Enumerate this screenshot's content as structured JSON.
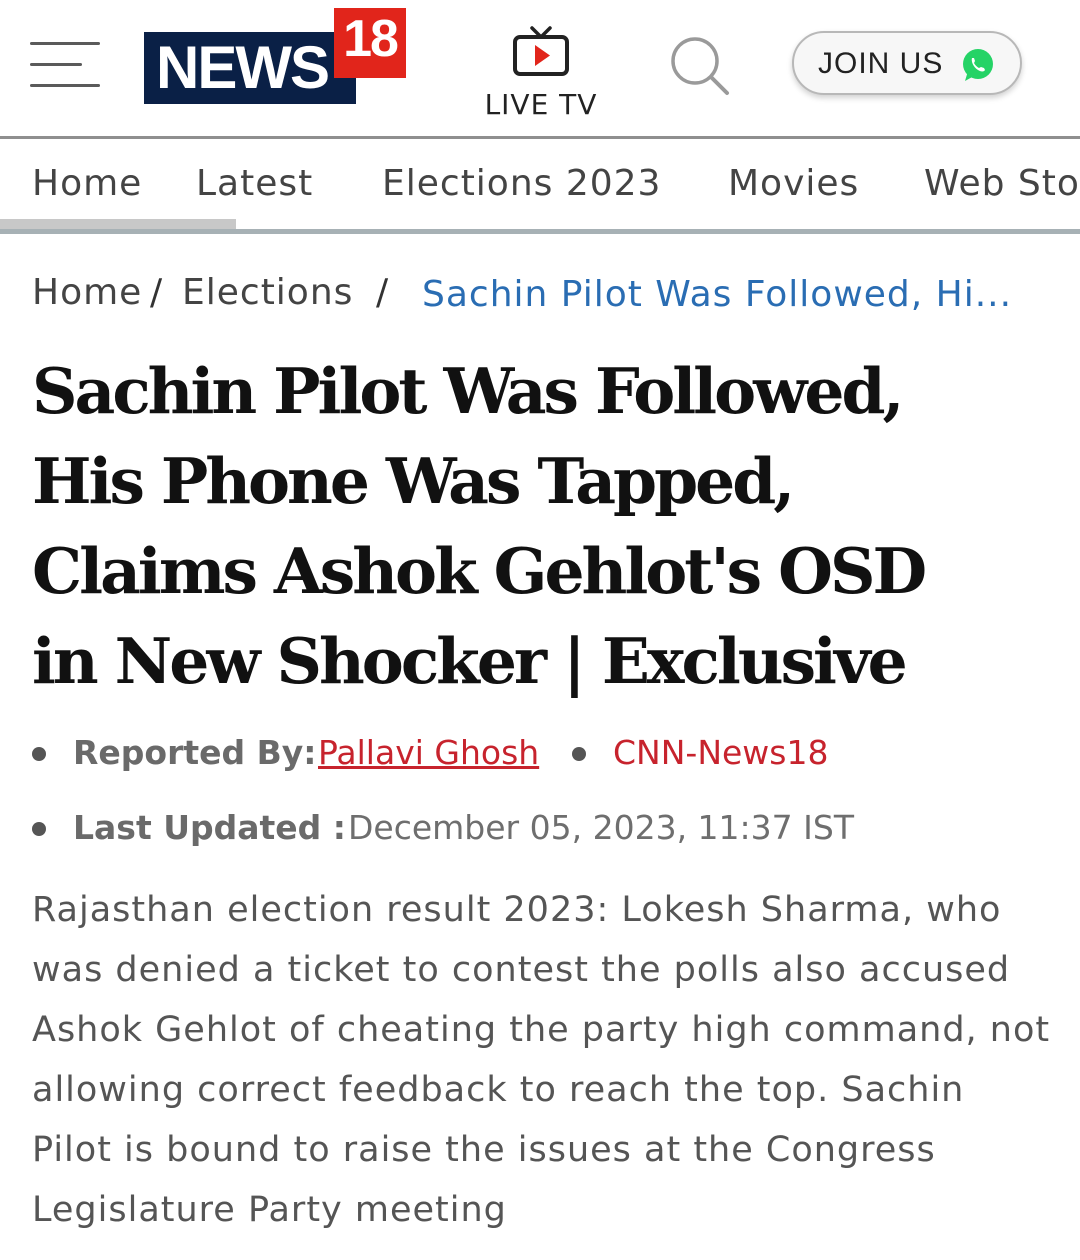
{
  "header": {
    "logo_text": "NEWS",
    "logo_number": "18",
    "live_tv_label": "LIVE TV",
    "join_label": "JOIN US",
    "icons": [
      "menu-icon",
      "live-tv-icon",
      "search-icon",
      "whatsapp-icon"
    ],
    "colors": {
      "logo_navy": "#0a2046",
      "logo_red": "#e1251b",
      "whatsapp_green": "#25d366"
    }
  },
  "nav": {
    "items": [
      {
        "label": "Home",
        "active": true
      },
      {
        "label": "Latest"
      },
      {
        "label": "Elections 2023"
      },
      {
        "label": "Movies"
      },
      {
        "label": "Web Sto"
      }
    ]
  },
  "breadcrumb": {
    "home": "Home",
    "section": "Elections",
    "separator": "/",
    "current": "Sachin Pilot Was Followed, Hi..."
  },
  "article": {
    "headline_lines": [
      "Sachin Pilot Was Followed,",
      "His Phone Was Tapped,",
      "Claims Ashok Gehlot's OSD",
      "in New Shocker | Exclusive"
    ],
    "reported_by_label": "Reported By:",
    "author": "Pallavi Ghosh",
    "source": "CNN-News18",
    "last_updated_label": "Last Updated :",
    "last_updated": "December 05, 2023, 11:37 IST",
    "summary": "Rajasthan election result 2023: Lokesh Sharma, who was denied a ticket to contest the polls also accused Ashok Gehlot of cheating the party high command, not allowing correct feedback to reach the top. Sachin Pilot is bound to raise the issues at the Congress Legislature Party meeting"
  }
}
